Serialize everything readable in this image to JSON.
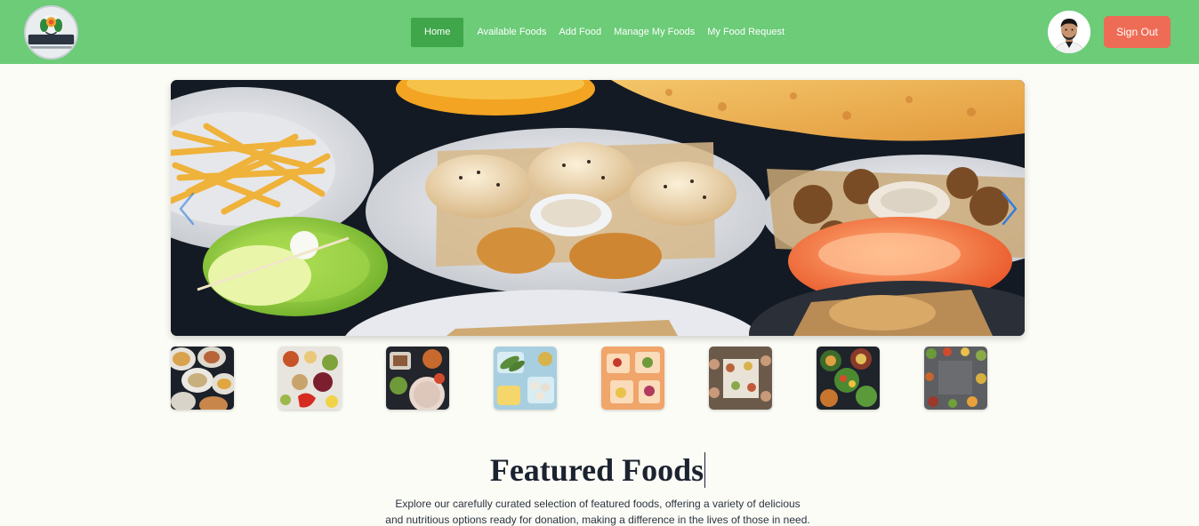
{
  "navbar": {
    "logo_text": "FOOD for ALL",
    "links": [
      "Home",
      "Available Foods",
      "Add Food",
      "Manage My Foods",
      "My Food Request"
    ],
    "active_link": "Home",
    "signout_label": "Sign Out",
    "avatar_icon": "user-avatar",
    "colors": {
      "bar": "#6ccc78",
      "active": "#3fa64a",
      "signout": "#ee6c55"
    }
  },
  "hero": {
    "prev_icon": "chevron-left-icon",
    "next_icon": "chevron-right-icon",
    "arrow_color": "#2f7de1"
  },
  "thumbnails": [
    "thumbnail-food-1",
    "thumbnail-food-2",
    "thumbnail-food-3",
    "thumbnail-food-4",
    "thumbnail-food-5",
    "thumbnail-food-6",
    "thumbnail-food-7",
    "thumbnail-food-8"
  ],
  "featured": {
    "title": "Featured Foods",
    "description_line1": "Explore our carefully curated selection of featured foods, offering a variety of delicious",
    "description_line2": "and nutritious options ready for donation, making a difference in the lives of those in need."
  }
}
